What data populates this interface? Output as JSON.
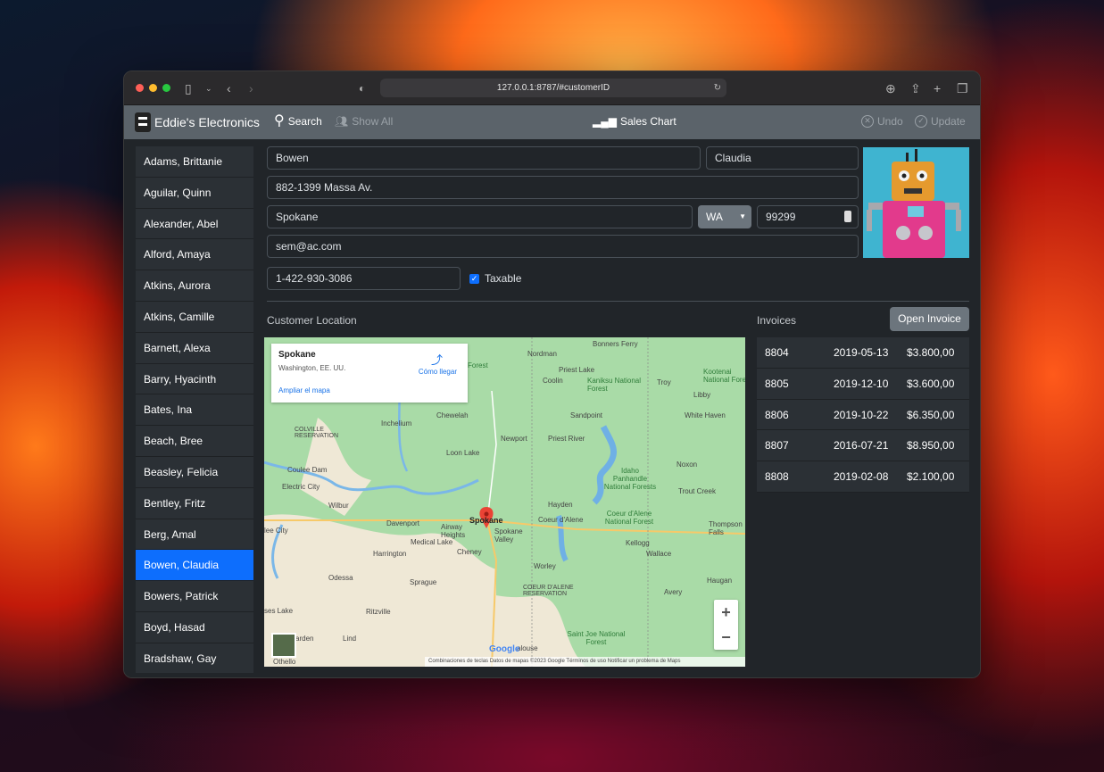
{
  "browser": {
    "url": "127.0.0.1:8787/#customerID"
  },
  "navbar": {
    "brand": "Eddie's Electronics",
    "search_label": "Search",
    "show_all_label": "Show All",
    "sales_chart_label": "Sales Chart",
    "undo_label": "Undo",
    "update_label": "Update"
  },
  "customers": [
    "Adams, Brittanie",
    "Aguilar, Quinn",
    "Alexander, Abel",
    "Alford, Amaya",
    "Atkins, Aurora",
    "Atkins, Camille",
    "Barnett, Alexa",
    "Barry, Hyacinth",
    "Bates, Ina",
    "Beach, Bree",
    "Beasley, Felicia",
    "Bentley, Fritz",
    "Berg, Amal",
    "Bowen, Claudia",
    "Bowers, Patrick",
    "Boyd, Hasad",
    "Bradshaw, Gay"
  ],
  "selected_customer": "Bowen, Claudia",
  "form": {
    "last_name": "Bowen",
    "first_name": "Claudia",
    "address": "882-1399 Massa Av.",
    "city": "Spokane",
    "state": "WA",
    "zip": "99299",
    "email": "sem@ac.com",
    "phone": "1-422-930-3086",
    "taxable_label": "Taxable",
    "taxable": true
  },
  "location_label": "Customer Location",
  "map": {
    "place_title": "Spokane",
    "place_subtitle": "Washington, EE. UU.",
    "directions_label": "Cómo llegar",
    "enlarge_label": "Ampliar el mapa",
    "footer": "Combinaciones de teclas    Datos de mapas ©2023 Google    Términos de uso    Notificar un problema de Maps",
    "google": "Google",
    "labels": {
      "bonners_ferry": "Bonners Ferry",
      "nordman": "Nordman",
      "priest_lake": "Priest Lake",
      "coolin": "Coolin",
      "kaniksu": "Kaniksu National Forest",
      "troy": "Troy",
      "libby": "Libby",
      "kootenai": "Kootenai National Fore",
      "chewelah": "Chewelah",
      "inchelium": "Inchelium",
      "sandpoint": "Sandpoint",
      "white_haven": "White Haven",
      "colville_res": "COLVILLE RESERVATION",
      "newport": "Newport",
      "priest_river": "Priest River",
      "loon_lake": "Loon Lake",
      "coulee_dam": "Coulee Dam",
      "noxon": "Noxon",
      "idaho_panhandle": "Idaho Panhandle National Forests",
      "electric_city": "Electric City",
      "trout_creek": "Trout Creek",
      "wilbur": "Wilbur",
      "hayden": "Hayden",
      "davenport": "Davenport",
      "spokane": "Spokane",
      "coeur_dalene": "Coeur d'Alene",
      "coeur_nf": "Coeur d'Alene National Forest",
      "airway_heights": "Airway Heights",
      "spokane_valley": "Spokane Valley",
      "thompson_falls": "Thompson Falls",
      "medical_lake": "Medical Lake",
      "harrington": "Harrington",
      "cheney": "Cheney",
      "kellogg": "Kellogg",
      "wallace": "Wallace",
      "worley": "Worley",
      "odessa": "Odessa",
      "sprague": "Sprague",
      "coeur_res": "COEUR D'ALENE RESERVATION",
      "haugan": "Haugan",
      "avery": "Avery",
      "ritzville": "Ritzville",
      "saint_joe": "Saint Joe National Forest",
      "lind": "Lind",
      "othello": "Othello",
      "soap_lake": "ses Lake",
      "warden": "arden",
      "lee_city": "lee City",
      "rosalia": "alouse",
      "forest": "Forest"
    }
  },
  "invoices_label": "Invoices",
  "open_invoice_label": "Open Invoice",
  "invoices": [
    {
      "id": "8804",
      "date": "2019-05-13",
      "amount": "$3.800,00"
    },
    {
      "id": "8805",
      "date": "2019-12-10",
      "amount": "$3.600,00"
    },
    {
      "id": "8806",
      "date": "2019-10-22",
      "amount": "$6.350,00"
    },
    {
      "id": "8807",
      "date": "2016-07-21",
      "amount": "$8.950,00"
    },
    {
      "id": "8808",
      "date": "2019-02-08",
      "amount": "$2.100,00"
    }
  ],
  "colors": {
    "accent": "#0d6efd",
    "navbar": "#5b636a",
    "panel": "#212529",
    "row": "#2b3035",
    "map_green": "#a7dca6",
    "map_pin": "#ea4335"
  }
}
